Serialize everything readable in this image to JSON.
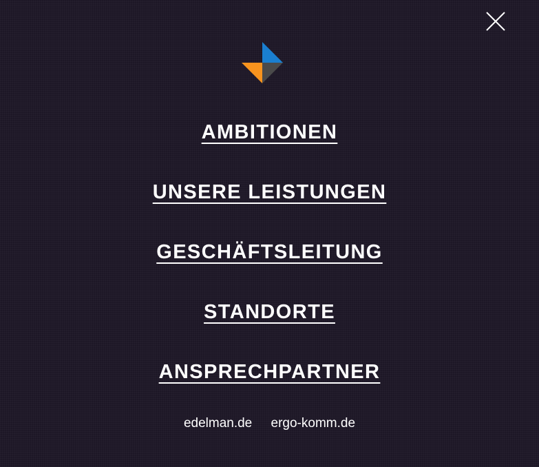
{
  "colors": {
    "background": "#1d1726",
    "text": "#ffffff",
    "logo_blue": "#1a7fd0",
    "logo_orange": "#f7931e",
    "logo_gray": "#4a4a4a"
  },
  "header": {
    "close_icon": "close-x-icon",
    "logo_icon": "brand-logo-icon"
  },
  "nav": {
    "items": [
      {
        "label": "AMBITIONEN"
      },
      {
        "label": "UNSERE LEISTUNGEN"
      },
      {
        "label": "GESCHÄFTSLEITUNG"
      },
      {
        "label": "STANDORTE"
      },
      {
        "label": "ANSPRECHPARTNER"
      }
    ]
  },
  "footer": {
    "links": [
      {
        "label": "edelman.de"
      },
      {
        "label": "ergo-komm.de"
      }
    ]
  }
}
